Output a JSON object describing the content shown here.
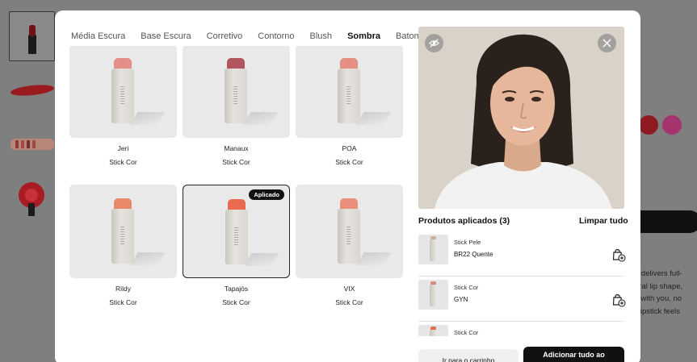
{
  "background": {
    "side_text_lines": [
      "e delivers full-",
      "ural lip shape,",
      "s with you, no",
      "l lipstick feels"
    ],
    "swatches": [
      "#8e1a22",
      "#a5336e"
    ]
  },
  "tabs": [
    {
      "label": "Média Escura",
      "active": false
    },
    {
      "label": "Base Escura",
      "active": false
    },
    {
      "label": "Corretivo",
      "active": false
    },
    {
      "label": "Contorno",
      "active": false
    },
    {
      "label": "Blush",
      "active": false
    },
    {
      "label": "Sombra",
      "active": true
    },
    {
      "label": "Batom",
      "active": false
    }
  ],
  "products": [
    {
      "name": "Jeri",
      "type": "Stick Cor",
      "tip_color": "#e38f88"
    },
    {
      "name": "Manaux",
      "type": "Stick Cor",
      "tip_color": "#b2555f"
    },
    {
      "name": "POA",
      "type": "Stick Cor",
      "tip_color": "#e58f82"
    },
    {
      "name": "Rildy",
      "type": "Stick Cor",
      "tip_color": "#e88a6a"
    },
    {
      "name": "Tapajós",
      "type": "Stick Cor",
      "tip_color": "#e96a50",
      "badge": "Aplicado"
    },
    {
      "name": "VIX",
      "type": "Stick Cor",
      "tip_color": "#e8907a"
    }
  ],
  "applied": {
    "title": "Produtos aplicados (3)",
    "clear_label": "Limpar tudo",
    "items": [
      {
        "line1": "Stick Pele",
        "line2": "BR22 Quente",
        "tip_color": "#c9b39a"
      },
      {
        "line1": "Stick Cor",
        "line2": "GYN",
        "tip_color": "#d98b7d"
      },
      {
        "line1": "Stick Cor",
        "line2": "",
        "tip_color": "#e96a50"
      }
    ]
  },
  "buttons": {
    "cart": "Ir para o carrinho",
    "add_all": "Adicionar tudo ao"
  },
  "icons": {
    "hide": "eye-off-icon",
    "close": "close-icon",
    "bag": "bag-plus-icon"
  }
}
